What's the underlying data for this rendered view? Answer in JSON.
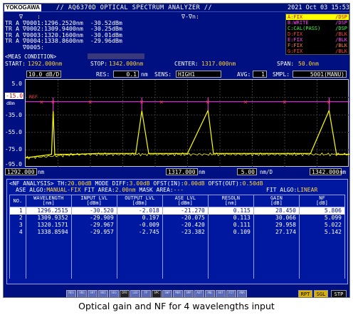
{
  "title_bar": {
    "brand": "YOKOGAWA",
    "title": "// AQ6370D OPTICAL SPECTRUM ANALYZER //",
    "datetime": "2021 Oct 03 15:53"
  },
  "markers": {
    "header_marker": "∇",
    "header_sep": ":",
    "delta_label": "∇-∇n:",
    "rows": [
      {
        "trace": "TR A",
        "name": "∇0001:",
        "wavelength": "1296.2520nm",
        "level": "-30.52dBm"
      },
      {
        "trace": "TR A",
        "name": "∇0002:",
        "wavelength": "1309.9400nm",
        "level": "-30.25dBm"
      },
      {
        "trace": "TR A",
        "name": "∇0003:",
        "wavelength": "1320.1600nm",
        "level": "-30.01dBm"
      },
      {
        "trace": "TR A",
        "name": "∇0004:",
        "wavelength": "1338.8600nm",
        "level": "-29.96dBm"
      },
      {
        "trace": "",
        "name": "∇0005:",
        "wavelength": "",
        "level": ""
      }
    ]
  },
  "traces": [
    {
      "name": "A:FIX",
      "mode": "/DSP",
      "color": "#ffff00",
      "selected": true
    },
    {
      "name": "B:WRITE",
      "mode": "/DSP",
      "color": "#ff40ff",
      "selected": false
    },
    {
      "name": "C:CAL(PASS)",
      "mode": "/DSP",
      "color": "#40ff40",
      "selected": false
    },
    {
      "name": "D:FIX",
      "mode": "/BLK",
      "color": "#ff4040",
      "selected": false
    },
    {
      "name": "E:FIX",
      "mode": "/BLK",
      "color": "#ff40ff",
      "selected": false
    },
    {
      "name": "F:FIX",
      "mode": "/BLK",
      "color": "#ff8040",
      "selected": false
    },
    {
      "name": "G:FIX",
      "mode": "/BLK",
      "color": "#ff4040",
      "selected": false
    }
  ],
  "conditions": {
    "label": "<MEAS CONDITION>",
    "start_label": "START:",
    "start": "1292.000nm",
    "stop_label": "STOP:",
    "stop": "1342.000nm",
    "center_label": "CENTER:",
    "center": "1317.000nm",
    "span_label": "SPAN:",
    "span": "50.0nm",
    "ref_scale": "10.0",
    "ref_scale_unit": "dB/D",
    "res_label": "RES:",
    "res": "0.1",
    "res_unit": "nm",
    "sens_label": "SENS:",
    "sens": "HIGH1",
    "avg_label": "AVG:",
    "avg": "1",
    "smpl_label": "SMPL:",
    "smpl": "5001(MANU)"
  },
  "plot": {
    "ref_level": "-15.0",
    "ref_tag": "REF",
    "ref_unit": "dBm",
    "y_ticks": [
      "5.0",
      "-15.0",
      "-35.0",
      "-55.0",
      "-75.0",
      "-95.0"
    ],
    "x_start": "1292.000",
    "x_center": "1317.000",
    "x_div": "5.00",
    "x_stop": "1342.000",
    "x_unit": "nm",
    "x_div_unit": "nm/D"
  },
  "chart_data": {
    "type": "line",
    "x_range": [
      1292.0,
      1342.0
    ],
    "y_range": [
      -95.0,
      5.0
    ],
    "ylabel": "dBm",
    "series": [
      {
        "name": "A:FIX",
        "color": "#ffff00",
        "x": [
          1292,
          1293,
          1294,
          1295,
          1296,
          1296.25,
          1296.5,
          1298,
          1300,
          1303,
          1306,
          1309,
          1309.94,
          1311,
          1314,
          1317,
          1320.16,
          1321,
          1324,
          1327,
          1330,
          1333,
          1336,
          1338.86,
          1340,
          1342
        ],
        "y": [
          -84,
          -83,
          -82,
          -81,
          -80,
          -30.5,
          -80,
          -80,
          -80,
          -79,
          -79,
          -79,
          -30.3,
          -79,
          -79,
          -79,
          -30.0,
          -79,
          -79,
          -79,
          -79,
          -79,
          -79,
          -30.0,
          -80,
          -80
        ]
      },
      {
        "name": "B:WRITE",
        "color": "#ff40ff",
        "x": [
          1292,
          1296.25,
          1309.94,
          1320.16,
          1338.86,
          1342
        ],
        "y": [
          -20,
          -20,
          -20,
          -20,
          -20,
          -20
        ]
      }
    ],
    "markers": [
      {
        "x": 1296.252,
        "y": -30.52
      },
      {
        "x": 1309.94,
        "y": -30.25
      },
      {
        "x": 1320.16,
        "y": -30.01
      },
      {
        "x": 1338.86,
        "y": -29.96
      }
    ]
  },
  "nf_analysis": {
    "title": "<NF ANALYSIS>",
    "th_label": "TH:",
    "th": "20.00dB",
    "mode_diff_label": "MODE DIFF:",
    "mode_diff": "3.00dB",
    "ofst_in_label": "OFST(IN):",
    "ofst_in": "0.00dB",
    "ofst_out_label": "OFST(OUT):",
    "ofst_out": "0.50dB",
    "ase_algo_label": "ASE ALGO:",
    "ase_algo": "MANUAL-FIX",
    "fit_area_label": "FIT AREA:",
    "fit_area": "2.00nm",
    "mask_area_label": "MASK AREA:",
    "mask_area": "---",
    "fit_algo_label": "FIT ALGO:",
    "fit_algo": "LINEAR",
    "columns": [
      {
        "name": "NO.",
        "unit": ""
      },
      {
        "name": "WAVELENGTH",
        "unit": "[nm]"
      },
      {
        "name": "INPUT LVL",
        "unit": "[dBm]"
      },
      {
        "name": "OUTPUT LVL",
        "unit": "[dBm]"
      },
      {
        "name": "ASE LVL",
        "unit": "[dBm]"
      },
      {
        "name": "RESOLN",
        "unit": "[nm]"
      },
      {
        "name": "GAIN",
        "unit": "[dB]"
      },
      {
        "name": "NF",
        "unit": "[dB]"
      }
    ],
    "rows": [
      [
        "1",
        "1296.2515",
        "-30.520",
        "-2.018",
        "-21.270",
        "0.115",
        "28.450",
        "5.806"
      ],
      [
        "2",
        "1309.9352",
        "-29.909",
        "0.197",
        "-20.075",
        "0.113",
        "30.066",
        "5.099"
      ],
      [
        "3",
        "1320.1571",
        "-29.967",
        "-0.009",
        "-20.420",
        "0.111",
        "29.958",
        "5.022"
      ],
      [
        "4",
        "1338.8594",
        "-29.957",
        "-2.745",
        "-23.382",
        "0.109",
        "27.174",
        "5.142"
      ]
    ]
  },
  "softkeys": [
    "RES",
    "SNS",
    "SRT",
    "NOI",
    "SEG",
    "DFB",
    "LED",
    "FP",
    "SPC",
    "SWP",
    "MKR",
    "SMP",
    "AUT",
    "ANL",
    "AUT",
    "FIT",
    "ANA"
  ],
  "function_keys": {
    "rpt": "RPT",
    "sgl": "SGL",
    "stp": "STP"
  },
  "caption": "Optical gain and NF for 4 wavelengths input"
}
